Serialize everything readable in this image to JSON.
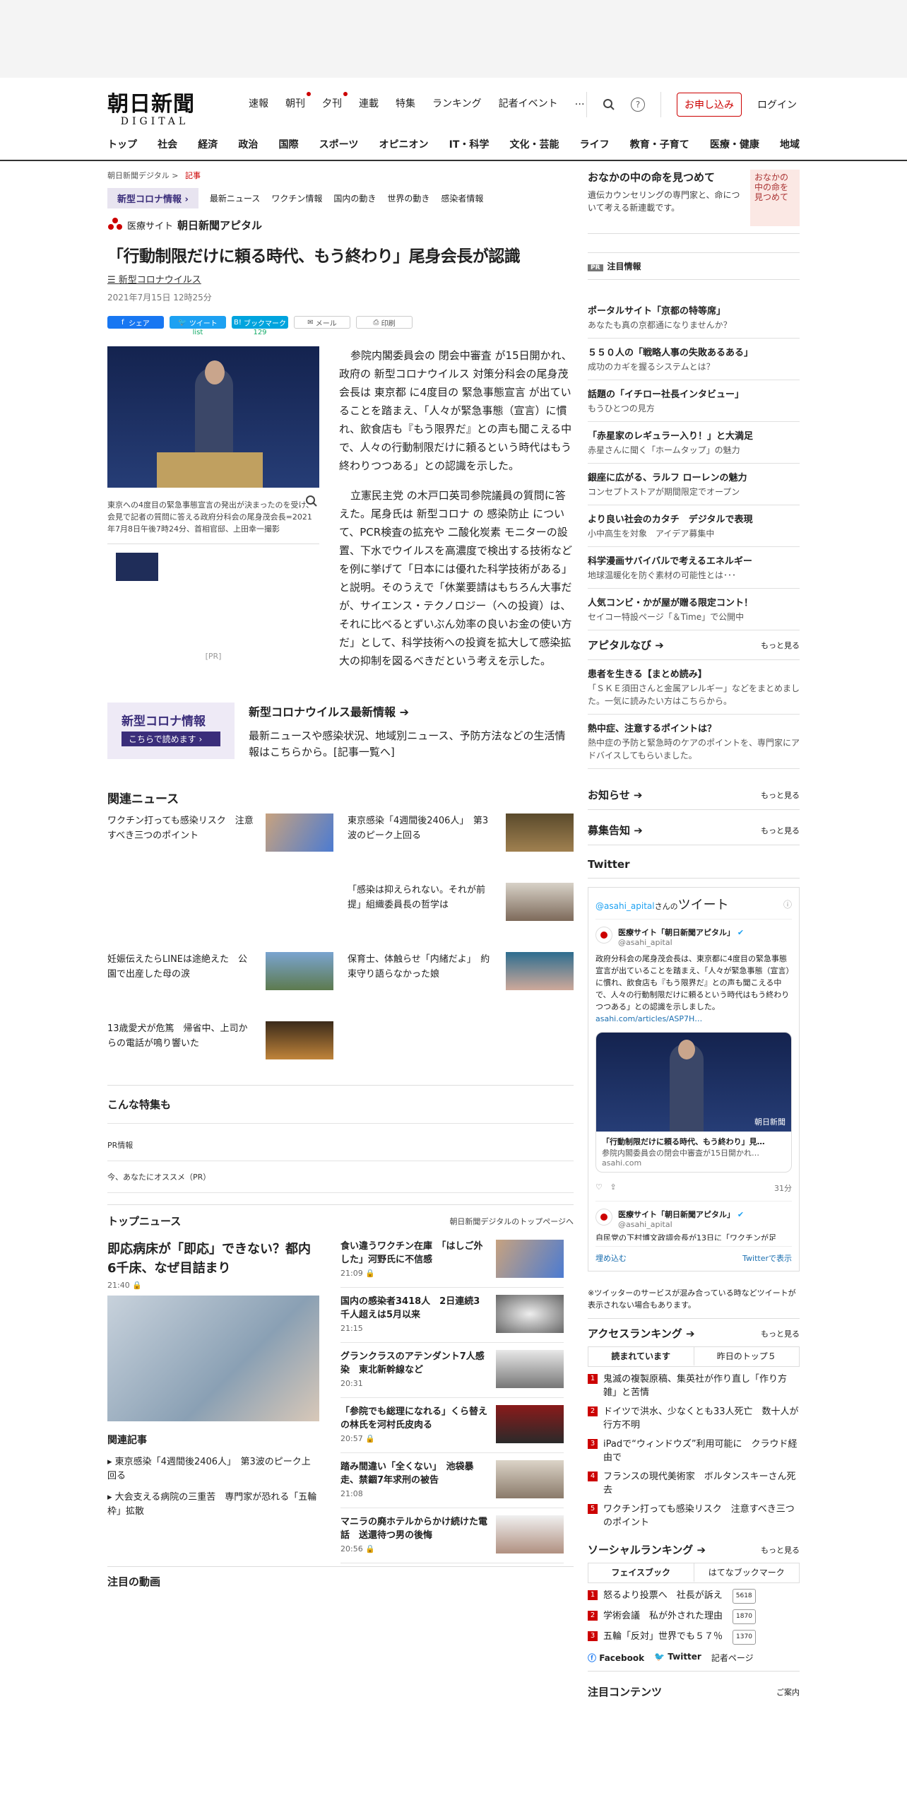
{
  "header": {
    "logo_main": "朝日新聞",
    "logo_sub": "DIGITAL",
    "nav": [
      "速報",
      "朝刊",
      "夕刊",
      "連載",
      "特集",
      "ランキング",
      "記者イベント",
      "…"
    ],
    "subscribe": "お申し込み",
    "login": "ログイン",
    "help": "?"
  },
  "cat_nav": [
    "トップ",
    "社会",
    "経済",
    "政治",
    "国際",
    "スポーツ",
    "オピニオン",
    "IT・科学",
    "文化・芸能",
    "ライフ",
    "教育・子育て",
    "医療・健康",
    "地域"
  ],
  "crumb": {
    "site": "朝日新聞デジタル",
    "page": "記事"
  },
  "corona_bar": {
    "button": "新型コロナ情報",
    "links": [
      "最新ニュース",
      "ワクチン情報",
      "国内の動き",
      "世界の動き",
      "感染者情報"
    ]
  },
  "media": {
    "prefix": "医療サイト",
    "name": "朝日新聞アピタル"
  },
  "article": {
    "title": "「行動制限だけに頼る時代、もう終わり」尾身会長が認識",
    "tag": "新型コロナウイルス",
    "date": "2021年7月15日 12時25分",
    "share": {
      "fb": "シェア",
      "tw": "ツイート",
      "tw_count": "list",
      "hb": "ブックマーク",
      "hb_count": "129",
      "mail": "メール",
      "print": "印刷"
    },
    "caption": "東京への4度目の緊急事態宣言の発出が決まったのを受け、会見で記者の質問に答える政府分科会の尾身茂会長=2021年7月8日午後7時24分、首相官邸、上田幸一撮影",
    "p1": "参院内閣委員会の 閉会中審査 が15日開かれ、政府の 新型コロナウイルス 対策分科会の尾身茂会長は 東京都 に4度目の 緊急事態宣言 が出ていることを踏まえ、「人々が緊急事態（宣言）に慣れ、飲食店も『もう限界だ』との声も聞こえる中で、人々の行動制限だけに頼るという時代はもう終わりつつある」との認識を示した。",
    "p2": "立憲民主党 の木戸口英司参院議員の質問に答えた。尾身氏は 新型コロナ の 感染防止 について、PCR検査の拡充や 二酸化炭素 モニターの設置、下水でウイルスを高濃度で検出する技術などを例に挙げて「日本には優れた科学技術がある」と説明。そのうえで「休業要請はもちろん大事だが、サイエンス・テクノロジー（への投資）は、それに比べるとずいぶん効率の良いお金の使い方だ」として、科学技術への投資を拡大して感染拡大の抑制を図るべきだという考えを示した。",
    "pr": "[PR]"
  },
  "banner": {
    "img1": "新型コロナ情報",
    "img2": "こちらで読めます ›",
    "title": "新型コロナウイルス最新情報 ➔",
    "desc": "最新ニュースや感染状況、地域別ニュース、予防方法などの生活情報はこちらから。[記事一覧へ]"
  },
  "related": {
    "title": "関連ニュース",
    "items": [
      "ワクチン打っても感染リスク　注意すべき三つのポイント",
      "東京感染「4週間後2406人」　第3波のピーク上回る",
      "",
      "「感染は抑えられない。それが前提」組織委員長の哲学は",
      "妊娠伝えたらLINEは途絶えた　公園で出産した母の涙",
      "保育士、体触らせ「内緒だよ」　約束守り語らなかった娘",
      "13歳愛犬が危篤　帰省中、上司からの電話が鳴り響いた",
      ""
    ]
  },
  "feature": {
    "title": "こんな特集も",
    "pr": "PR情報",
    "osusume": "今、あなたにオススメ（PR）"
  },
  "top_news": {
    "title": "トップニュース",
    "link": "朝日新聞デジタルのトップページへ",
    "main_title": "即応病床が「即応」できない？都内6千床、なぜ目詰まり",
    "main_time": "21:40",
    "related_title": "関連記事",
    "related": [
      "東京感染「4週間後2406人」　第3波のピーク上回る",
      "大会支える病院の三重苦　専門家が恐れる「五輪枠」拡散"
    ],
    "items": [
      {
        "t": "食い違うワクチン在庫　「はしご外した」河野氏に不信感",
        "m": "21:09"
      },
      {
        "t": "国内の感染者3418人　2日連続3千人超えは5月以来",
        "m": "21:15"
      },
      {
        "t": "グランクラスのアテンダント7人感染　東北新幹線など",
        "m": "20:31"
      },
      {
        "t": "「参院でも総理になれる」くら替えの林氏を河村氏皮肉る",
        "m": "20:57"
      },
      {
        "t": "踏み間違い「全くない」　池袋暴走、禁錮7年求刑の被告",
        "m": "21:08"
      },
      {
        "t": "マニラの廃ホテルからかけ続けた電話　送還待つ男の後悔",
        "m": "20:56"
      }
    ]
  },
  "bottom_cut": "注目の動画",
  "side": {
    "promo_title": "おなかの中の命を見つめて",
    "promo_desc": "遺伝カウンセリングの専門家と、命について考える新連載です。",
    "promo_img": "おなかの中の命を見つめて",
    "attention": "注目情報",
    "pr_badge": "PR",
    "pr_items": [
      {
        "a": "ポータルサイト「京都の特等席」",
        "b": "あなたも真の京都通になりませんか？"
      },
      {
        "a": "５５０人の「戦略人事の失敗あるある」",
        "b": "成功のカギを握るシステムとは？"
      },
      {
        "a": "話題の「イチロー社長インタビュー」",
        "b": "もうひとつの見方"
      },
      {
        "a": "「赤星家のレギュラー入り！」と大満足",
        "b": "赤星さんに聞く「ホームタップ」の魅力"
      },
      {
        "a": "銀座に広がる、ラルフ ローレンの魅力",
        "b": "コンセプトストアが期間限定でオープン"
      },
      {
        "a": "より良い社会のカタチ　デジタルで表現",
        "b": "小中高生を対象　アイデア募集中"
      },
      {
        "a": "科学漫画サバイバルで考えるエネルギー",
        "b": "地球温暖化を防ぐ素材の可能性とは･･･"
      },
      {
        "a": "人気コンビ・かが屋が贈る限定コント！",
        "b": "セイコー特設ページ「＆Time」で公開中"
      }
    ],
    "apital": "アピタルなび ➔",
    "more": "もっと見る",
    "apital_items": [
      {
        "a": "患者を生きる【まとめ読み】",
        "b": "「ＳＫＥ須田さんと金属アレルギー」などをまとめました。一気に読みたい方はこちらから。"
      },
      {
        "a": "熱中症、注意するポイントは？",
        "b": "熱中症の予防と緊急時のケアのポイントを、専門家にアドバイスしてもらいました。"
      }
    ],
    "notice": "お知らせ ➔",
    "recruit": "募集告知 ➔",
    "twitter": "Twitter",
    "tw_head_user": "@asahi_apital",
    "tw_head_san": "さんの",
    "tw_head_title": "ツイート",
    "tw_name": "医療サイト「朝日新聞アピタル」",
    "tw_handle": "@asahi_apital",
    "tw_text": "政府分科会の尾身茂会長は、東京都に4度目の緊急事態宣言が出ていることを踏まえ、「人々が緊急事態（宣言）に慣れ、飲食店も『もう限界だ』との声も聞こえる中で、人々の行動制限だけに頼るという時代はもう終わりつつある」との認識を示しました。",
    "tw_link": "asahi.com/articles/ASP7H…",
    "card_title": "「行動制限だけに頼る時代、もう終わり」見…",
    "card_desc": "参院内閣委員会の閉会中審査が15日開かれ…",
    "card_domain": "asahi.com",
    "card_brand": "朝日新聞",
    "tw_time": "31分",
    "tw2_text": "自民党の下村博文政調会長が13日に「ワクチンが足",
    "embed": "埋め込む",
    "view": "Twitterで表示",
    "tw_note": "※ツイッターのサービスが混み合っている時などツイートが表示されない場合もあります。",
    "access": "アクセスランキング ➔",
    "tab1": "読まれています",
    "tab2": "昨日のトップ５",
    "access_items": [
      "鬼滅の複製原稿、集英社が作り直し「作り方雑」と苦情",
      "ドイツで洪水、少なくとも33人死亡　数十人が行方不明",
      "iPadで“ウィンドウズ”利用可能に　クラウド経由で",
      "フランスの現代美術家　ボルタンスキーさん死去",
      "ワクチン打っても感染リスク　注意すべき三つのポイント"
    ],
    "social": "ソーシャルランキング ➔",
    "tab3": "フェイスブック",
    "tab4": "はてなブックマーク",
    "social_items": [
      {
        "t": "怒るより投票へ　社長が訴え",
        "n": "5618"
      },
      {
        "t": "学術会議　私が外された理由",
        "n": "1870"
      },
      {
        "t": "五輪「反対」世界でも５７％",
        "n": "1370"
      }
    ],
    "fb": "Facebook",
    "tw": "Twitter",
    "reporter": "記者ページ",
    "featured": "注目コンテンツ",
    "guide": "ご案内"
  },
  "colors": {
    "accent": "#c00000",
    "twitter": "#1da1f2",
    "facebook": "#1877f2",
    "hatena": "#00a4de"
  }
}
